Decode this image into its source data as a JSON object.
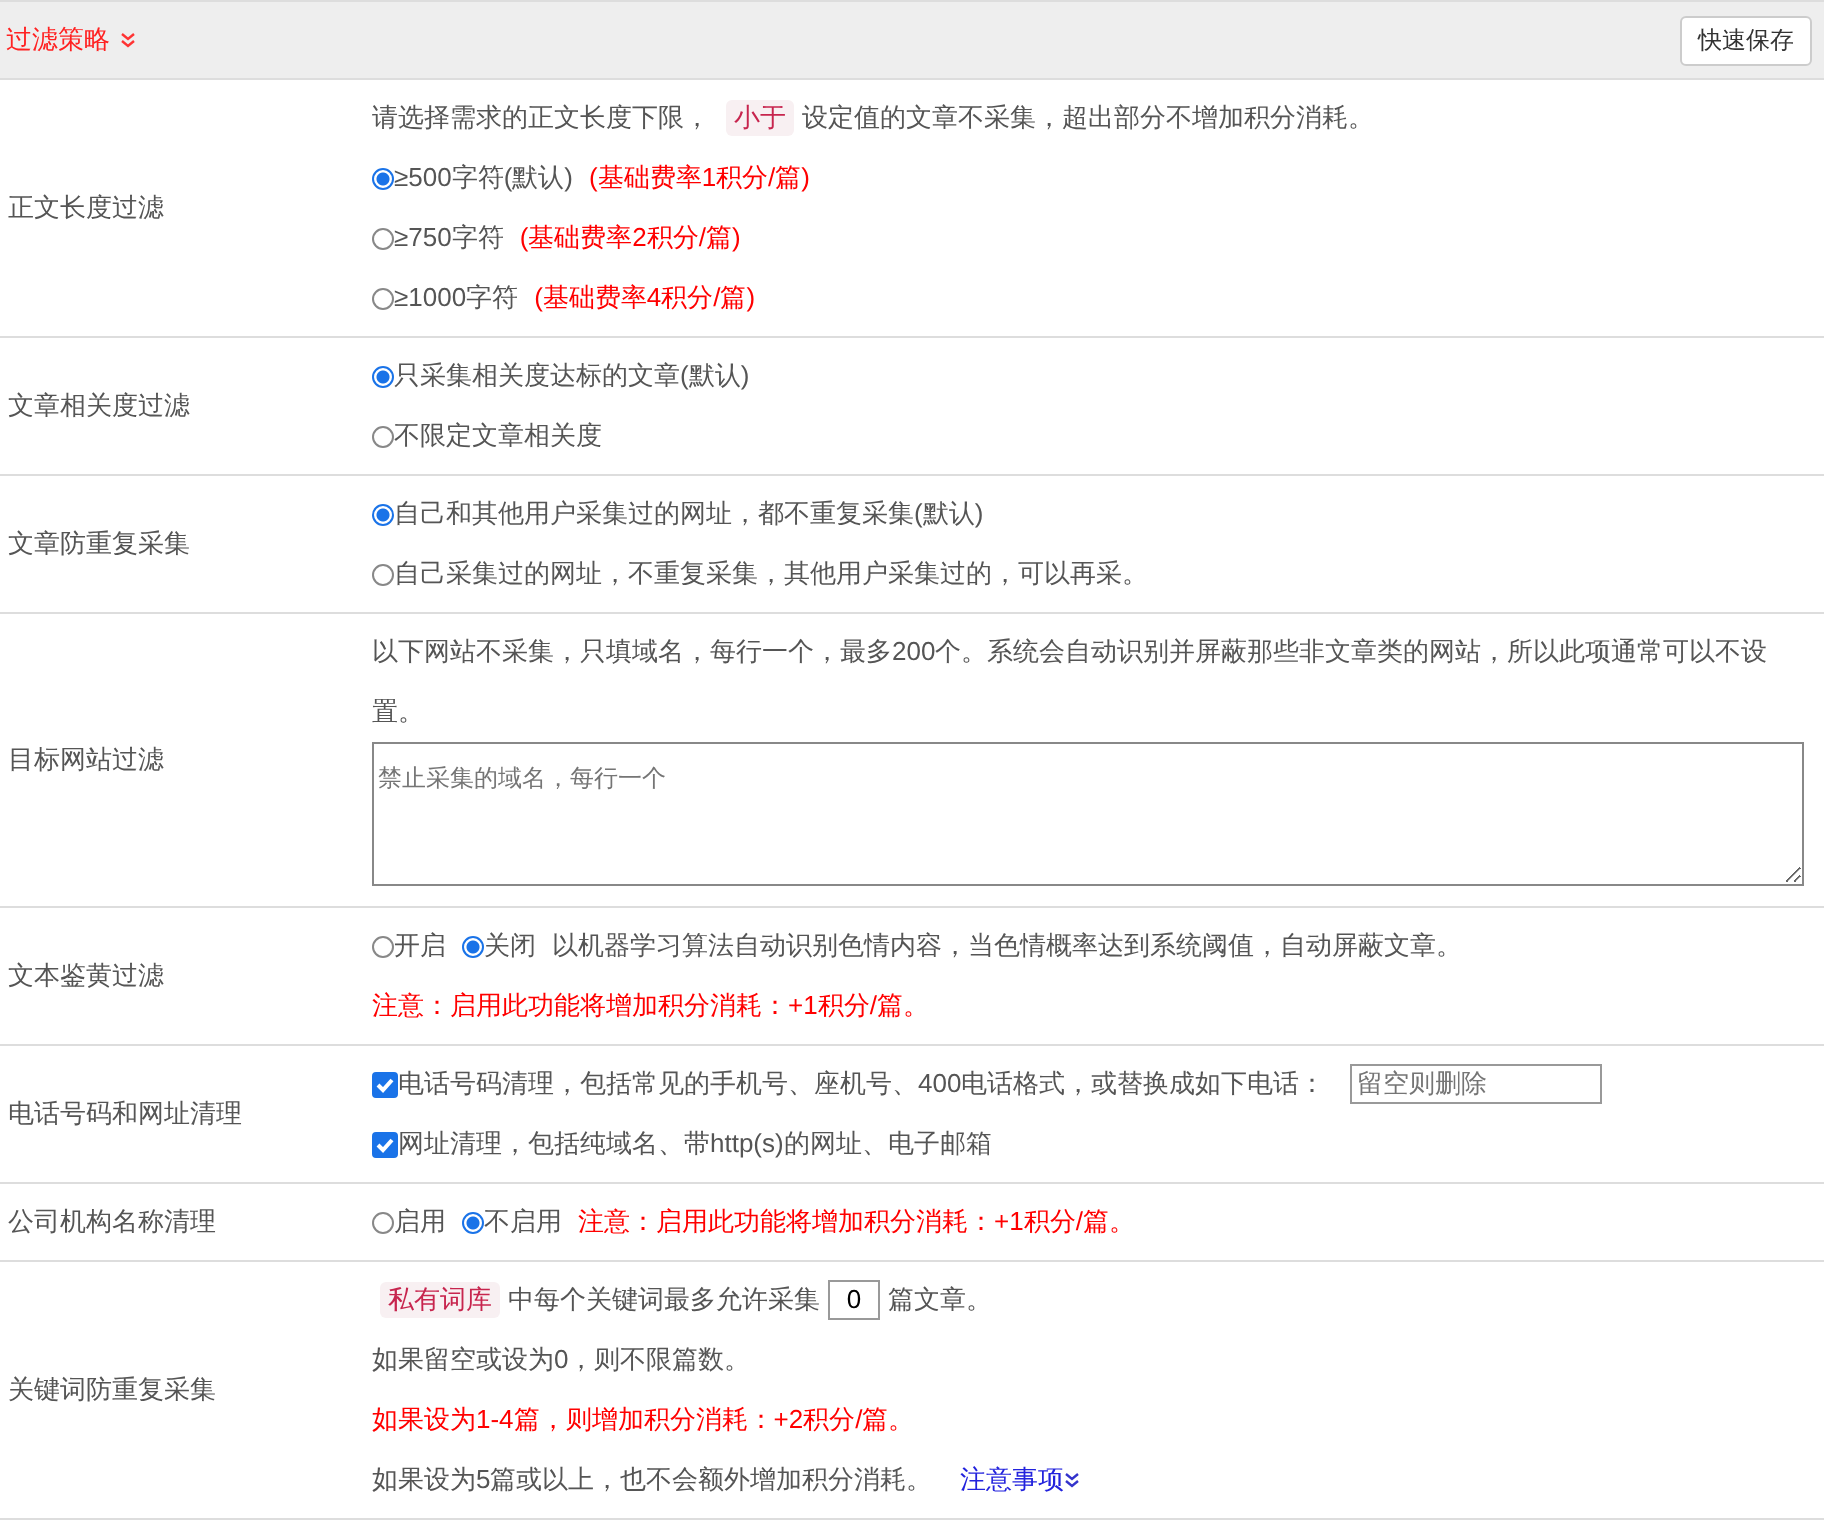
{
  "header": {
    "title": "过滤策略",
    "save_button": "快速保存"
  },
  "rows": [
    {
      "label": "正文长度过滤",
      "lines": [
        {
          "parts": [
            {
              "kind": "text",
              "text": "请选择需求的正文长度下限，"
            },
            {
              "kind": "tag",
              "text": "小于"
            },
            {
              "kind": "text",
              "text": "设定值的文章不采集，超出部分不增加积分消耗。"
            }
          ]
        },
        {
          "parts": [
            {
              "kind": "radio",
              "label": "≥500字符(默认)",
              "selected": true
            },
            {
              "kind": "red",
              "text": "(基础费率1积分/篇)"
            }
          ]
        },
        {
          "parts": [
            {
              "kind": "radio",
              "label": "≥750字符",
              "selected": false
            },
            {
              "kind": "red",
              "text": "(基础费率2积分/篇)"
            }
          ]
        },
        {
          "parts": [
            {
              "kind": "radio",
              "label": "≥1000字符",
              "selected": false
            },
            {
              "kind": "red",
              "text": "(基础费率4积分/篇)"
            }
          ]
        }
      ]
    },
    {
      "label": "文章相关度过滤",
      "lines": [
        {
          "parts": [
            {
              "kind": "radio",
              "label": "只采集相关度达标的文章(默认)",
              "selected": true
            }
          ]
        },
        {
          "parts": [
            {
              "kind": "radio",
              "label": "不限定文章相关度",
              "selected": false
            }
          ]
        }
      ]
    },
    {
      "label": "文章防重复采集",
      "lines": [
        {
          "parts": [
            {
              "kind": "radio",
              "label": "自己和其他用户采集过的网址，都不重复采集(默认)",
              "selected": true
            }
          ]
        },
        {
          "parts": [
            {
              "kind": "radio",
              "label": "自己采集过的网址，不重复采集，其他用户采集过的，可以再采。",
              "selected": false
            }
          ]
        }
      ]
    },
    {
      "label": "目标网站过滤",
      "lines": [
        {
          "parts": [
            {
              "kind": "text",
              "text": "以下网站不采集，只填域名，每行一个，最多200个。系统会自动识别并屏蔽那些非文章类的网站，所以此项通常可以不设置。"
            }
          ]
        },
        {
          "parts": [
            {
              "kind": "textarea",
              "placeholder": "禁止采集的域名，每行一个"
            }
          ]
        }
      ]
    },
    {
      "label": "文本鉴黄过滤",
      "lines": [
        {
          "parts": [
            {
              "kind": "radio",
              "label": "开启",
              "selected": false
            },
            {
              "kind": "radio",
              "label": "关闭",
              "selected": true
            },
            {
              "kind": "text",
              "text": "以机器学习算法自动识别色情内容，当色情概率达到系统阈值，自动屏蔽文章。"
            }
          ]
        },
        {
          "parts": [
            {
              "kind": "red",
              "text": "注意：启用此功能将增加积分消耗：+1积分/篇。"
            }
          ]
        }
      ]
    },
    {
      "label": "电话号码和网址清理",
      "lines": [
        {
          "parts": [
            {
              "kind": "checkbox",
              "label": "电话号码清理，包括常见的手机号、座机号、400电话格式，或替换成如下电话：",
              "checked": true
            },
            {
              "kind": "input",
              "placeholder": "留空则删除"
            }
          ]
        },
        {
          "parts": [
            {
              "kind": "checkbox",
              "label": "网址清理，包括纯域名、带http(s)的网址、电子邮箱",
              "checked": true
            }
          ]
        }
      ]
    },
    {
      "label": "公司机构名称清理",
      "lines": [
        {
          "parts": [
            {
              "kind": "radio",
              "label": "启用",
              "selected": false
            },
            {
              "kind": "radio",
              "label": "不启用",
              "selected": true
            },
            {
              "kind": "red",
              "text": "注意：启用此功能将增加积分消耗：+1积分/篇。"
            }
          ]
        }
      ]
    },
    {
      "label": "关键词防重复采集",
      "lines": [
        {
          "parts": [
            {
              "kind": "tag",
              "text": "私有词库"
            },
            {
              "kind": "text",
              "text": "中每个关键词最多允许采集"
            },
            {
              "kind": "number",
              "value": "0"
            },
            {
              "kind": "text",
              "text": "篇文章。"
            }
          ]
        },
        {
          "parts": [
            {
              "kind": "text",
              "text": "如果留空或设为0，则不限篇数。"
            }
          ]
        },
        {
          "parts": [
            {
              "kind": "red",
              "text": "如果设为1-4篇，则增加积分消耗：+2积分/篇。"
            }
          ]
        },
        {
          "parts": [
            {
              "kind": "text",
              "text": "如果设为5篇或以上，也不会额外增加积分消耗。"
            },
            {
              "kind": "link",
              "text": "注意事项"
            }
          ]
        }
      ]
    }
  ]
}
